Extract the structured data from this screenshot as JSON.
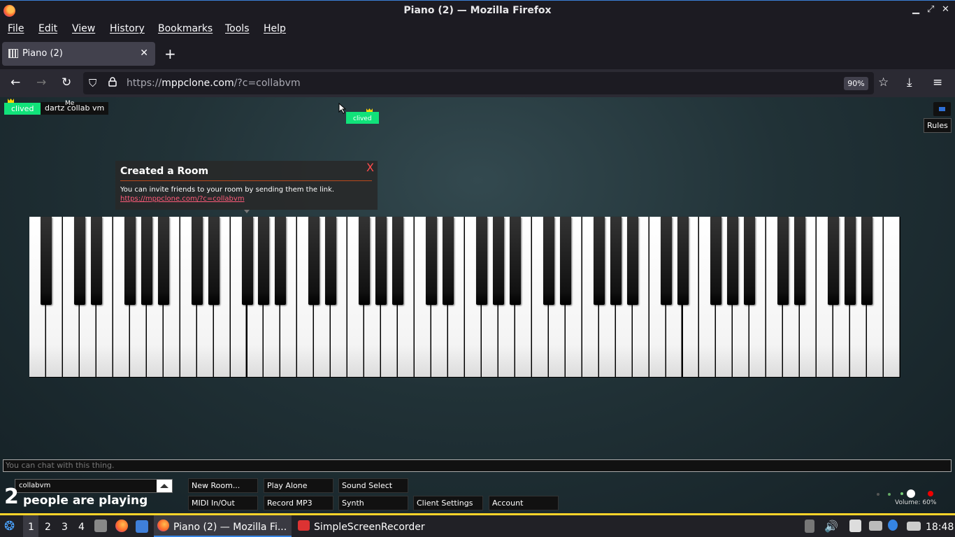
{
  "window": {
    "title": "Piano (2) — Mozilla Firefox"
  },
  "menu": [
    "File",
    "Edit",
    "View",
    "History",
    "Bookmarks",
    "Tools",
    "Help"
  ],
  "tab": {
    "title": "Piano (2)"
  },
  "url": {
    "prefix": "https://",
    "host": "mppclone.com",
    "path": "/?c=collabvm",
    "zoom": "90%"
  },
  "page": {
    "users": [
      {
        "name": "clived",
        "color": "#11e27a",
        "crown": true
      },
      {
        "name": "clived",
        "color": "#11e27a",
        "crown": true
      }
    ],
    "me_label": "Me",
    "me_name": "dartz collab vm",
    "rules": "Rules",
    "notice": {
      "title": "Created a Room",
      "close": "X",
      "text": "You can invite friends to your room by sending them the link.",
      "link": "https://mppclone.com/?c=collabvm"
    },
    "chat_placeholder": "You can chat with this thing.",
    "room_name": "collabvm",
    "people_count": "2",
    "people_text": "people are playing",
    "buttons": {
      "new_room": "New Room...",
      "play_alone": "Play Alone",
      "sound_select": "Sound Select",
      "midi": "MIDI In/Out",
      "record": "Record MP3",
      "synth": "Synth",
      "client_settings": "Client Settings",
      "account": "Account"
    },
    "volume": "Volume: 60%"
  },
  "taskbar": {
    "workspaces": [
      "1",
      "2",
      "3",
      "4"
    ],
    "apps": [
      "Piano (2) — Mozilla Fi...",
      "SimpleScreenRecorder"
    ],
    "clock": "18:48"
  }
}
